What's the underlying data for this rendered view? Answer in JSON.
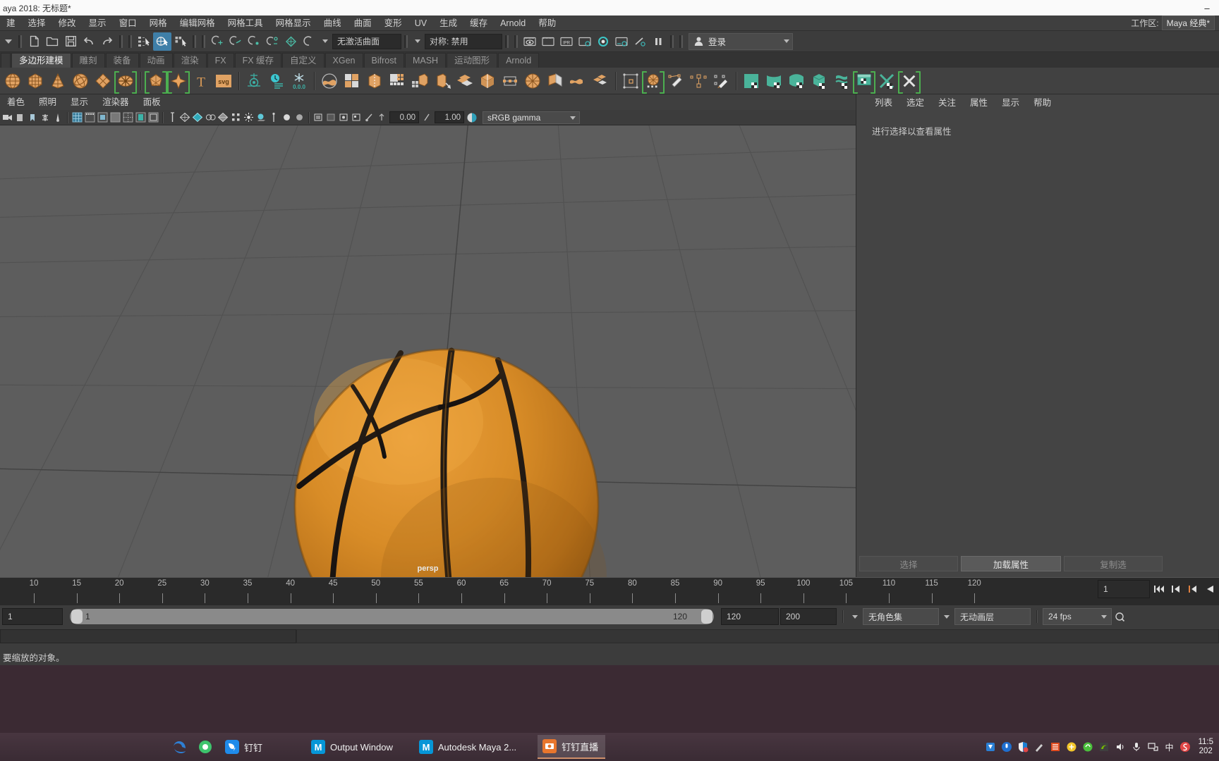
{
  "window": {
    "title": "aya 2018: 无标题*",
    "minimize": "–",
    "maximize": "□",
    "close": "✕"
  },
  "main_menu": {
    "items": [
      "建",
      "选择",
      "修改",
      "显示",
      "窗口",
      "网格",
      "编辑网格",
      "网格工具",
      "网格显示",
      "曲线",
      "曲面",
      "变形",
      "UV",
      "生成",
      "缓存",
      "Arnold",
      "帮助"
    ],
    "workspace_label": "工作区:",
    "workspace_value": "Maya 经典*"
  },
  "status_bar": {
    "curve_field": "无激活曲面",
    "symmetry_field": "对称: 禁用",
    "login_label": "登录"
  },
  "shelf_tabs": {
    "items": [
      "多边形建模",
      "雕刻",
      "装备",
      "动画",
      "渲染",
      "FX",
      "FX 缓存",
      "自定义",
      "XGen",
      "Bifrost",
      "MASH",
      "运动图形",
      "Arnold"
    ],
    "selected_index": 0
  },
  "viewport_menu": {
    "items": [
      "着色",
      "照明",
      "显示",
      "渲染器",
      "面板"
    ]
  },
  "viewport_tools": {
    "exposure": "0.00",
    "gamma": "1.00",
    "color_space": "sRGB gamma"
  },
  "viewport": {
    "camera_label": "persp",
    "background_color": "#5d5d5d",
    "grid_color": "#4a4a4a",
    "object": {
      "name": "basketball",
      "base_color": "#d08a2a",
      "shadow_color": "#8f5a12",
      "seam_color": "#1c1c1c"
    }
  },
  "attribute_editor": {
    "menu": [
      "列表",
      "选定",
      "关注",
      "属性",
      "显示",
      "帮助"
    ],
    "empty_message": "进行选择以查看属性",
    "buttons": [
      "选择",
      "加载属性",
      "复制选"
    ]
  },
  "time_slider": {
    "ticks": [
      10,
      15,
      20,
      25,
      30,
      35,
      40,
      45,
      50,
      55,
      60,
      65,
      70,
      75,
      80,
      85,
      90,
      95,
      100,
      105,
      110,
      115,
      120
    ],
    "current_frame": "1",
    "playback_buttons": [
      "⏮",
      "◀|",
      "|◀",
      "◀"
    ]
  },
  "range_bar": {
    "start_field": "1",
    "range_start": "1",
    "range_end": "120",
    "end_field": "120",
    "playback_end": "200",
    "character_set": "无角色集",
    "anim_layer": "无动画层",
    "fps": "24 fps"
  },
  "help_line": {
    "text": "要缩放的对象。"
  },
  "taskbar": {
    "apps": [
      {
        "label": "钉钉",
        "icon": "dingtalk-icon",
        "active": false
      },
      {
        "label": "Output Window",
        "icon": "maya-icon",
        "active": false
      },
      {
        "label": "Autodesk Maya 2...",
        "icon": "maya-icon",
        "active": false
      },
      {
        "label": "钉钉直播",
        "icon": "dingtalk-live-icon",
        "active": true
      }
    ],
    "tray_lang": "中",
    "clock_time": "11:5",
    "clock_date": "202"
  }
}
